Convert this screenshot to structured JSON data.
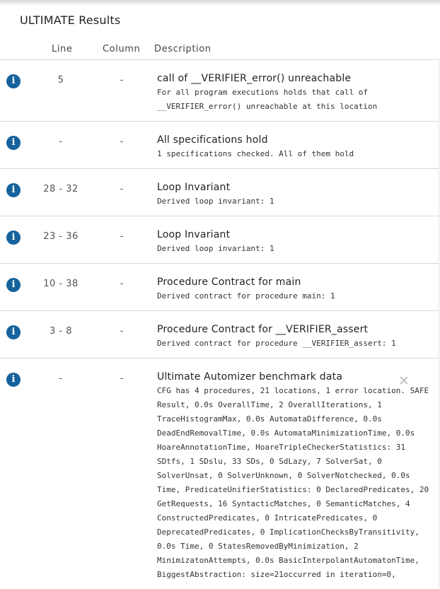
{
  "panel": {
    "title": "ULTIMATE Results"
  },
  "columns": {
    "line": "Line",
    "column": "Column",
    "description": "Description"
  },
  "results": [
    {
      "line": "5",
      "column": "-",
      "title": "call of __VERIFIER_error() unreachable",
      "text": "For all program executions holds that call of\n__VERIFIER_error() unreachable at this location"
    },
    {
      "line": "-",
      "column": "-",
      "title": "All specifications hold",
      "text": "1 specifications checked. All of them hold"
    },
    {
      "line": "28 - 32",
      "column": "-",
      "title": "Loop Invariant",
      "text": "Derived loop invariant: 1"
    },
    {
      "line": "23 - 36",
      "column": "-",
      "title": "Loop Invariant",
      "text": "Derived loop invariant: 1"
    },
    {
      "line": "10 - 38",
      "column": "-",
      "title": "Procedure Contract for main",
      "text": "Derived contract for procedure main: 1"
    },
    {
      "line": "3 - 8",
      "column": "-",
      "title": "Procedure Contract for __VERIFIER_assert",
      "text": "Derived contract for procedure __VERIFIER_assert: 1"
    },
    {
      "line": "-",
      "column": "-",
      "title": "Ultimate Automizer benchmark data",
      "text": "CFG has 4 procedures, 21 locations, 1 error location. SAFE\nResult, 0.0s OverallTime, 2 OverallIterations, 1\nTraceHistogramMax, 0.0s AutomataDifference, 0.0s\nDeadEndRemovalTime, 0.0s AutomataMinimizationTime, 0.0s\nHoareAnnotationTime, HoareTripleCheckerStatistics: 31\nSDtfs, 1 SDslu, 33 SDs, 0 SdLazy, 7 SolverSat, 0\nSolverUnsat, 0 SolverUnknown, 0 SolverNotchecked, 0.0s\nTime, PredicateUnifierStatistics: 0 DeclaredPredicates, 20\nGetRequests, 16 SyntacticMatches, 0 SemanticMatches, 4\nConstructedPredicates, 0 IntricatePredicates, 0\nDeprecatedPredicates, 0 ImplicationChecksByTransitivity,\n0.0s Time, 0 StatesRemovedByMinimization, 2\nMinimizatonAttempts, 0.0s BasicInterpolantAutomatonTime,\nBiggestAbstraction: size=21occurred in iteration=0,",
      "closable": true
    }
  ],
  "icons": {
    "info": "info-circle-icon",
    "close": "close-icon"
  },
  "colors": {
    "info_icon": "#16629c",
    "divider": "#d8d8d8"
  }
}
